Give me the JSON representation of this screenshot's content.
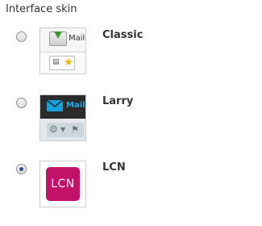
{
  "section": {
    "title": "Interface skin"
  },
  "skins": [
    {
      "name": "Classic",
      "selected": false,
      "thumb_text": "Mail"
    },
    {
      "name": "Larry",
      "selected": false,
      "thumb_text": "Mail"
    },
    {
      "name": "LCN",
      "selected": true,
      "thumb_text": "LCN"
    }
  ],
  "colors": {
    "classic_arrow": "#3a9a2c",
    "larry_header": "#2b2b2b",
    "larry_accent": "#19a9e2",
    "lcn_logo": "#c3126a",
    "radio_dot": "#2a4f8f"
  },
  "icons": {
    "classic": [
      "mail-download-icon",
      "grid-icon",
      "star-icon"
    ],
    "larry": [
      "envelope-icon",
      "gear-icon",
      "caret-down-icon",
      "flag-icon"
    ]
  }
}
